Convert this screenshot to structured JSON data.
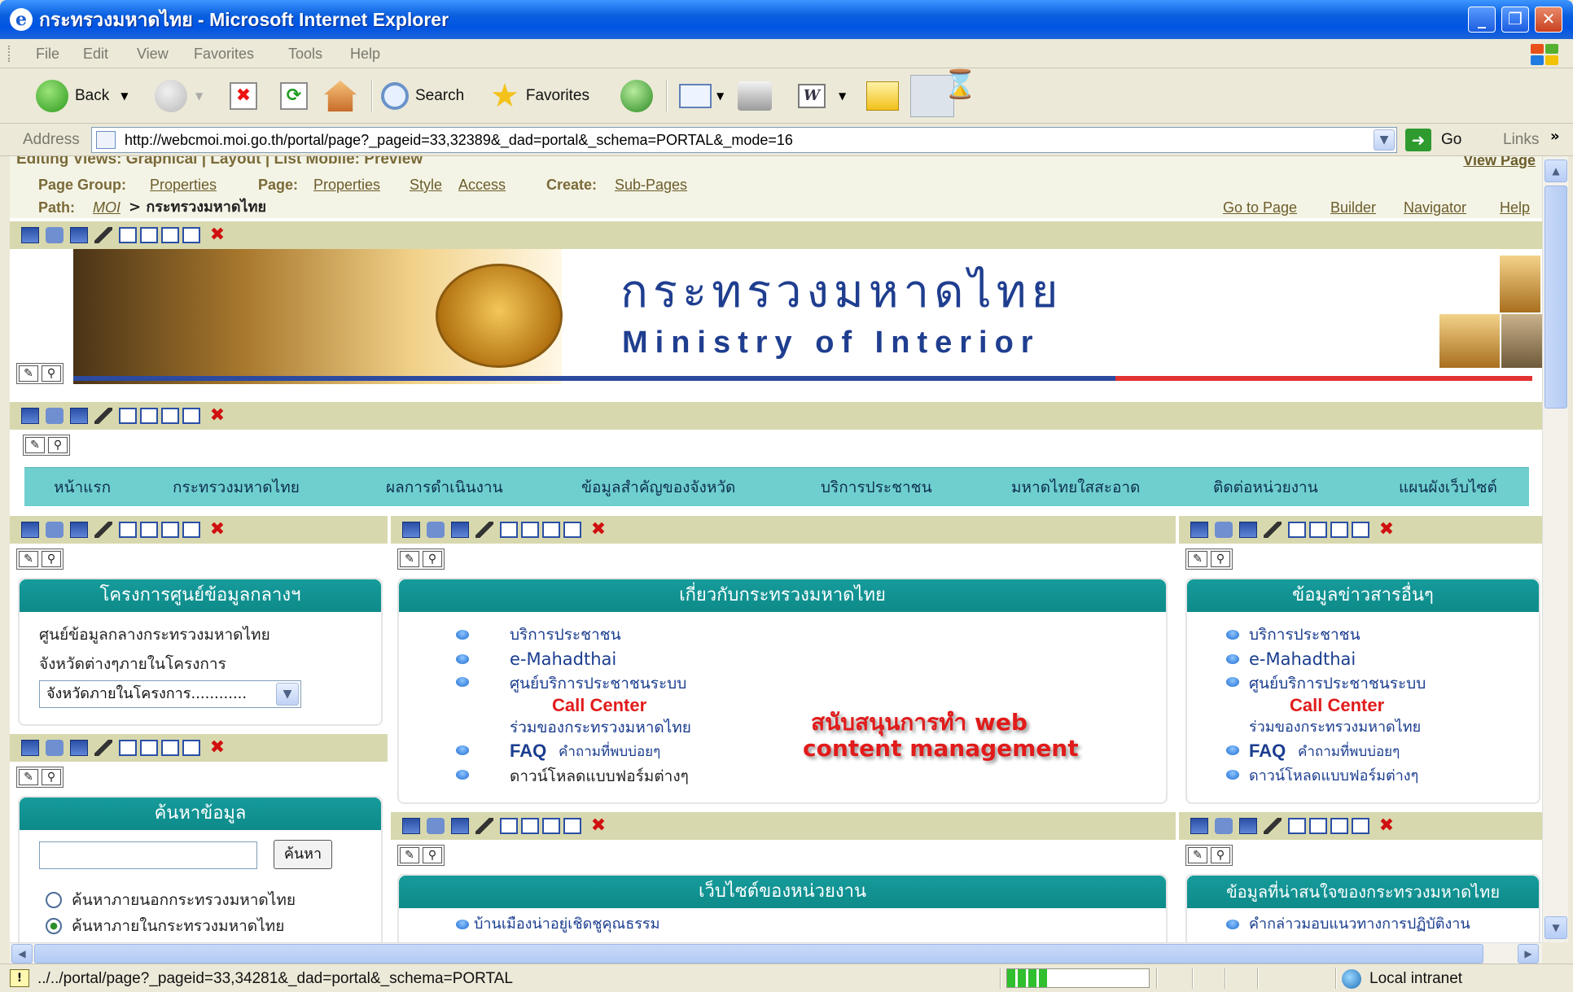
{
  "window": {
    "title": "กระทรวงมหาดไทย - Microsoft Internet Explorer",
    "minimize": "_",
    "restore": "❐",
    "close": "✕"
  },
  "menu": [
    "File",
    "Edit",
    "View",
    "Favorites",
    "Tools",
    "Help"
  ],
  "toolbar": {
    "back": "Back",
    "search": "Search",
    "favorites": "Favorites"
  },
  "address": {
    "label": "Address",
    "url": "http://webcmoi.moi.go.th/portal/page?_pageid=33,32389&_dad=portal&_schema=PORTAL&_mode=16",
    "go": "Go",
    "links": "Links"
  },
  "portal": {
    "edit_views": "Editing Views: Graphical | Layout | List   Mobile: Preview",
    "view_page": "View Page",
    "page_group_label": "Page Group:",
    "page_group_link": "Properties",
    "page_label": "Page:",
    "page_properties": "Properties",
    "page_style": "Style",
    "page_access": "Access",
    "create_label": "Create:",
    "create_link": "Sub-Pages",
    "path_label": "Path:",
    "path_root": "MOI",
    "path_current": "> กระทรวงมหาดไทย",
    "go_to_page": "Go to Page",
    "builder": "Builder",
    "navigator": "Navigator",
    "help": "Help"
  },
  "banner": {
    "thai_title": "กระทรวงมหาดไทย",
    "en_title": "Ministry of Interior"
  },
  "nav": [
    "หน้าแรก",
    "กระทรวงมหาดไทย",
    "ผลการดำเนินงาน",
    "ข้อมูลสำคัญของจังหวัด",
    "บริการประชาชน",
    "มหาดไทยใสสะอาด",
    "ติดต่อหน่วยงาน",
    "แผนผังเว็บไซต์"
  ],
  "left_panel": {
    "title": "โครงการศูนย์ข้อมูลกลางฯ",
    "line1": "ศูนย์ข้อมูลกลางกระทรวงมหาดไทย",
    "line2": "จังหวัดต่างๆภายในโครงการ",
    "select_value": "จังหวัดภายในโครงการ............"
  },
  "search_panel": {
    "title": "ค้นหาข้อมูล",
    "button": "ค้นหา",
    "opt1": "ค้นหาภายนอกกระทรวงมหาดไทย",
    "opt2": "ค้นหาภายในกระทรวงมหาดไทย"
  },
  "center_panel": {
    "title": "เกี่ยวกับกระทรวงมหาดไทย",
    "items": [
      "บริการประชาชน",
      "e-Mahadthai",
      "ศูนย์บริการประชาชนระบบ",
      "Call Center",
      "ร่วมของกระทรวงมหาดไทย",
      "FAQ",
      "คำถามที่พบบ่อยๆ",
      "ดาวน์โหลดแบบฟอร์มต่างๆ"
    ],
    "overlay_line1": "สนับสนุนการทำ web",
    "overlay_line2": "content management"
  },
  "right_panel": {
    "title": "ข้อมูลข่าวสารอื่นๆ",
    "items": [
      "บริการประชาชน",
      "e-Mahadthai",
      "ศูนย์บริการประชาชนระบบ",
      "Call Center",
      "ร่วมของกระทรวงมหาดไทย",
      "FAQ",
      "คำถามที่พบบ่อยๆ",
      "ดาวน์โหลดแบบฟอร์มต่างๆ"
    ]
  },
  "center_panel2": {
    "title": "เว็บไซต์ของหน่วยงาน",
    "item": "บ้านเมืองน่าอยู่เชิดชูคุณธรรม"
  },
  "right_panel2": {
    "title": "ข้อมูลที่น่าสนใจของกระทรวงมหาดไทย",
    "item": "คำกล่าวมอบแนวทางการปฏิบัติงาน"
  },
  "status": {
    "text": "../../portal/page?_pageid=33,34281&_dad=portal&_schema=PORTAL",
    "zone": "Local intranet"
  }
}
